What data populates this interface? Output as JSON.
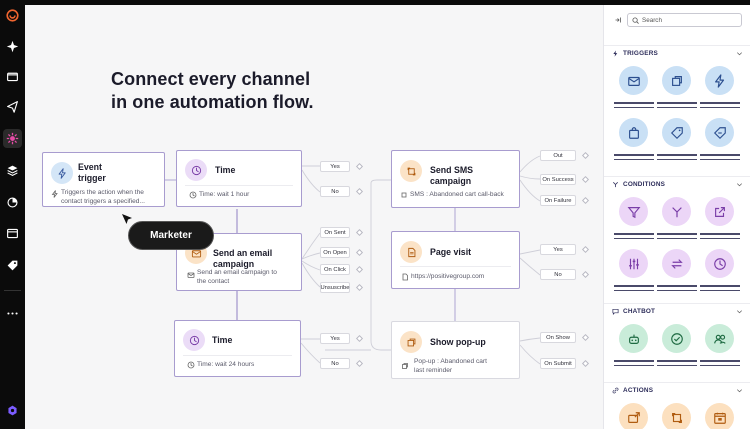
{
  "headline": {
    "line1": "Connect every channel",
    "line2": "in one automation flow."
  },
  "marker": "Marketer",
  "nodes": {
    "event": {
      "title_line1": "Event",
      "title_line2": "trigger",
      "desc_line1": "Triggers the action when the",
      "desc_line2": "contact triggers a specified..."
    },
    "time1": {
      "title": "Time",
      "desc": "Time: wait 1 hour"
    },
    "email": {
      "title_line1": "Send an email",
      "title_line2": "campaign",
      "desc_line1": "Send an email campaign to",
      "desc_line2": "the contact"
    },
    "time2": {
      "title": "Time",
      "desc": "Time: wait 24 hours"
    },
    "sms": {
      "title_line1": "Send SMS",
      "title_line2": "campaign",
      "desc": "SMS : Abandoned cart call-back"
    },
    "page_visit": {
      "title": "Page visit",
      "desc": "https://positivegroup.com"
    },
    "popup": {
      "title": "Show pop-up",
      "desc_line1": "Pop-up : Abandoned cart",
      "desc_line2": "last reminder"
    }
  },
  "branches": {
    "time1": [
      "Yes",
      "No"
    ],
    "email": [
      "On Sent",
      "On Open",
      "On Click",
      "Unsuscribe"
    ],
    "time2": [
      "Yes",
      "No"
    ],
    "sms": [
      "Out",
      "On Success",
      "On Failure"
    ],
    "page_visit": [
      "Yes",
      "No"
    ],
    "popup": [
      "On Show",
      "On Submit"
    ]
  },
  "panel": {
    "search_placeholder": "Search",
    "sections": {
      "triggers": "TRIGGERS",
      "conditions": "CONDITIONS",
      "chatbot": "CHATBOT",
      "actions": "ACTIONS"
    }
  },
  "icons": {
    "rail": [
      "brand-logo-icon",
      "sparkle-icon",
      "folder-icon",
      "send-icon",
      "automation-icon",
      "layers-icon",
      "pie-chart-icon",
      "browser-icon",
      "tag-icon",
      "more-icon",
      "profile-icon"
    ],
    "triggers": [
      "envelope-icon",
      "window-stack-icon",
      "lightning-icon",
      "shopping-bag-icon",
      "tag-icon",
      "tag-refresh-icon"
    ],
    "conditions": [
      "filter-icon",
      "split-icon",
      "external-link-icon",
      "sliders-icon",
      "swap-icon",
      "clock-icon"
    ],
    "chatbot": [
      "bot-icon",
      "check-circle-icon",
      "users-icon"
    ],
    "actions": [
      "envelope-send-icon",
      "refresh-square-icon",
      "calendar-icon"
    ]
  },
  "colors": {
    "accent": "#a89ccf",
    "rail_bg": "#0b0b0b",
    "active_rail": "#e44ca5",
    "heading": "#1b1b2a",
    "section_title": "#2d2d5a"
  }
}
